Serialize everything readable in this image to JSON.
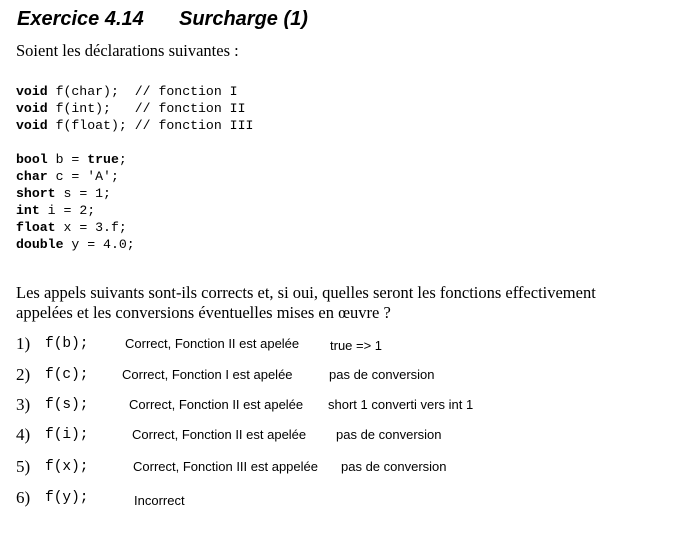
{
  "title": {
    "number": "Exercice 4.14",
    "name": "Surcharge (1)"
  },
  "intro": "Soient les déclarations suivantes :",
  "declarations": [
    {
      "type": "void",
      "rest": " f(char);  // fonction I"
    },
    {
      "type": "void",
      "rest": " f(int);   // fonction II"
    },
    {
      "type": "void",
      "rest": " f(float); // fonction III"
    }
  ],
  "variables": [
    {
      "type": "bool",
      "rest": " b = ",
      "value": "true",
      "end": ";"
    },
    {
      "type": "char",
      "rest": " c = 'A';",
      "value": "",
      "end": ""
    },
    {
      "type": "short",
      "rest": " s = 1;",
      "value": "",
      "end": ""
    },
    {
      "type": "int",
      "rest": " i = 2;",
      "value": "",
      "end": ""
    },
    {
      "type": "float",
      "rest": " x = 3.f;",
      "value": "",
      "end": ""
    },
    {
      "type": "double",
      "rest": " y = 4.0;",
      "value": "",
      "end": ""
    }
  ],
  "question": {
    "line1": "Les appels suivants sont-ils corrects et, si oui, quelles seront les fonctions effectivement",
    "line2": "appelées et les conversions éventuelles mises en œuvre ?"
  },
  "calls": [
    {
      "num": "1)",
      "expr": "f(b);",
      "verdict": "Correct, Fonction II est apelée",
      "detail": "true => 1"
    },
    {
      "num": "2)",
      "expr": "f(c);",
      "verdict": "Correct, Fonction I est apelée",
      "detail": "pas de conversion"
    },
    {
      "num": "3)",
      "expr": "f(s);",
      "verdict": "Correct, Fonction II est apelée",
      "detail": "short 1 converti vers int 1"
    },
    {
      "num": "4)",
      "expr": "f(i);",
      "verdict": "Correct, Fonction II est apelée",
      "detail": "pas de conversion"
    },
    {
      "num": "5)",
      "expr": "f(x);",
      "verdict": "Correct, Fonction III est appelée",
      "detail": "pas de conversion"
    },
    {
      "num": "6)",
      "expr": "f(y);",
      "verdict": "Incorrect",
      "detail": ""
    }
  ]
}
